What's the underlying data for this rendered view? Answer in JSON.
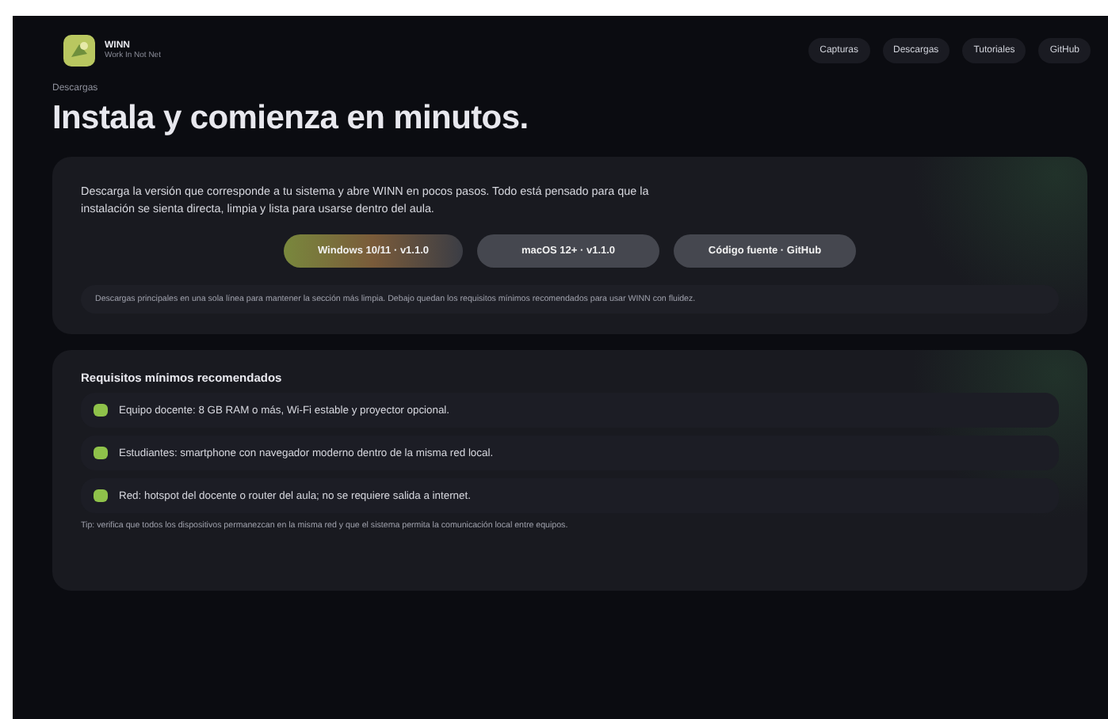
{
  "brand": {
    "name": "WINN",
    "tagline": "Work In Not Net"
  },
  "nav": [
    {
      "label": "Capturas"
    },
    {
      "label": "Descargas"
    },
    {
      "label": "Tutoriales"
    },
    {
      "label": "GitHub"
    }
  ],
  "eyebrow": "Descargas",
  "title": "Instala y comienza en minutos.",
  "download": {
    "intro": "Descarga la versión que corresponde a tu sistema y abre WINN en pocos pasos. Todo está pensado para que la instalación se sienta directa, limpia y lista para usarse dentro del aula.",
    "buttons": [
      {
        "label": "Windows 10/11 · v1.1.0",
        "kind": "primary"
      },
      {
        "label": "macOS 12+ · v1.1.0",
        "kind": "secondary"
      },
      {
        "label": "Código fuente · GitHub",
        "kind": "secondary"
      }
    ],
    "note": "Descargas principales en una sola línea para mantener la sección más limpia. Debajo quedan los requisitos mínimos recomendados para usar WINN con fluidez."
  },
  "requirements": {
    "heading": "Requisitos mínimos recomendados",
    "items": [
      "Equipo docente: 8 GB RAM o más, Wi-Fi estable y proyector opcional.",
      "Estudiantes: smartphone con navegador moderno dentro de la misma red local.",
      "Red: hotspot del docente o router del aula; no se requiere salida a internet."
    ],
    "tip": "Tip: verifica que todos los dispositivos permanezcan en la misma red y que el sistema permita la comunicación local entre equipos."
  }
}
